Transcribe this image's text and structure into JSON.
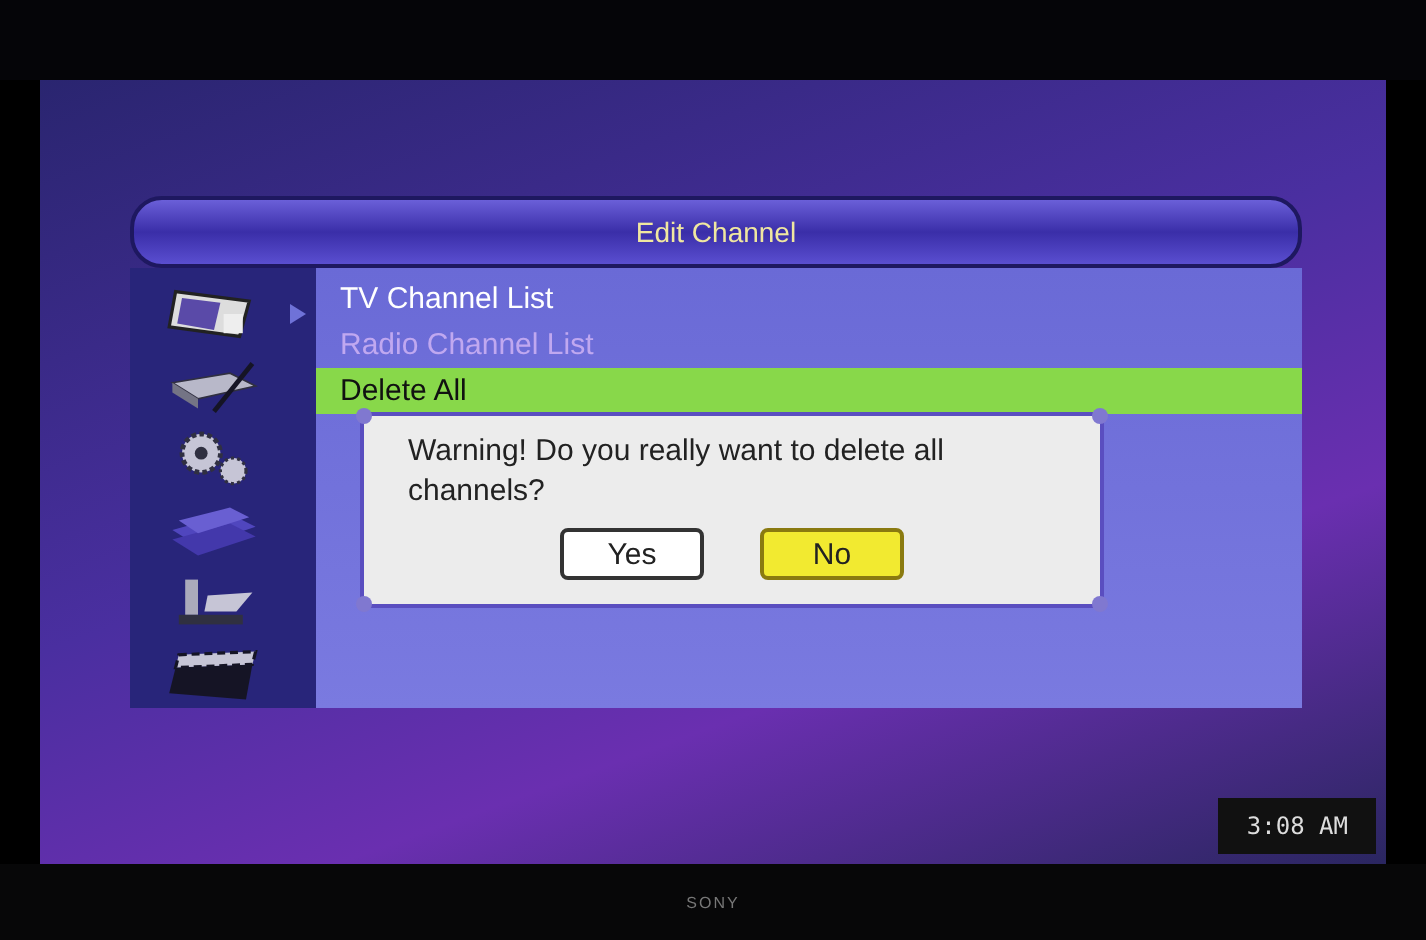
{
  "menu": {
    "title": "Edit Channel",
    "sidebar": [
      {
        "kind": "monitor",
        "selected": true
      },
      {
        "kind": "receiver",
        "selected": false
      },
      {
        "kind": "gears",
        "selected": false
      },
      {
        "kind": "stack",
        "selected": false
      },
      {
        "kind": "tools",
        "selected": false
      },
      {
        "kind": "clapper",
        "selected": false
      }
    ],
    "items": [
      {
        "label": "TV Channel List",
        "selected": false,
        "disabled": false
      },
      {
        "label": "Radio Channel List",
        "selected": false,
        "disabled": true
      },
      {
        "label": "Delete All",
        "selected": true,
        "disabled": false
      }
    ]
  },
  "dialog": {
    "message": "Warning! Do you really want to delete all channels?",
    "buttons": [
      {
        "label": "Yes",
        "selected": false
      },
      {
        "label": "No",
        "selected": true
      }
    ]
  },
  "clock": "3:08 AM",
  "bezel_logo": "SONY"
}
